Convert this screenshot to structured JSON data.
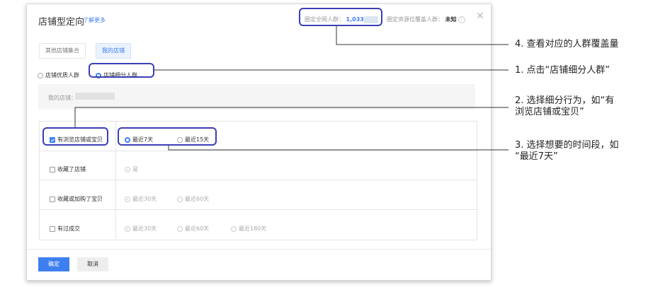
{
  "dialog": {
    "title": "店铺型定向",
    "learn_more": "了解更多",
    "metric_all_label": "圈定全网人群：",
    "metric_all_value": "1,033",
    "metric_res_label": "圈定资源位覆盖人群：",
    "metric_res_value": "未知",
    "help_symbol": "?",
    "close_symbol": "✕"
  },
  "tabs": [
    {
      "label": "其他店铺集合",
      "active": false
    },
    {
      "label": "我的店铺",
      "active": true
    }
  ],
  "radio_options": [
    {
      "label": "店铺优质人群",
      "checked": false
    },
    {
      "label": "店铺细分人群",
      "checked": true
    }
  ],
  "store": {
    "label": "我的店铺："
  },
  "behavior_rows": [
    {
      "label": "有浏览店铺或宝贝",
      "checked": true,
      "options": [
        "最近7天",
        "最近15天"
      ]
    },
    {
      "label": "收藏了店铺",
      "checked": false,
      "options": [
        "是"
      ]
    },
    {
      "label": "收藏或加购了宝贝",
      "checked": false,
      "options": [
        "最近30天",
        "最近60天"
      ]
    },
    {
      "label": "有过成交",
      "checked": false,
      "options": [
        "最近30天",
        "最近60天",
        "最近180天"
      ]
    }
  ],
  "buttons": {
    "confirm": "确定",
    "cancel": "取消"
  },
  "annotations": {
    "step4": "4. 查看对应的人群覆盖量",
    "step1": "1. 点击“店铺细分人群”",
    "step2_line1": "2. 选择细分行为，如“有",
    "step2_line2": "浏览店铺或宝贝”",
    "step3_line1": "3. 选择想要的时间段，如",
    "step3_line2": "“最近7天”"
  },
  "colors": {
    "accent": "#3d7ff0",
    "highlight": "#3b3fb6"
  }
}
